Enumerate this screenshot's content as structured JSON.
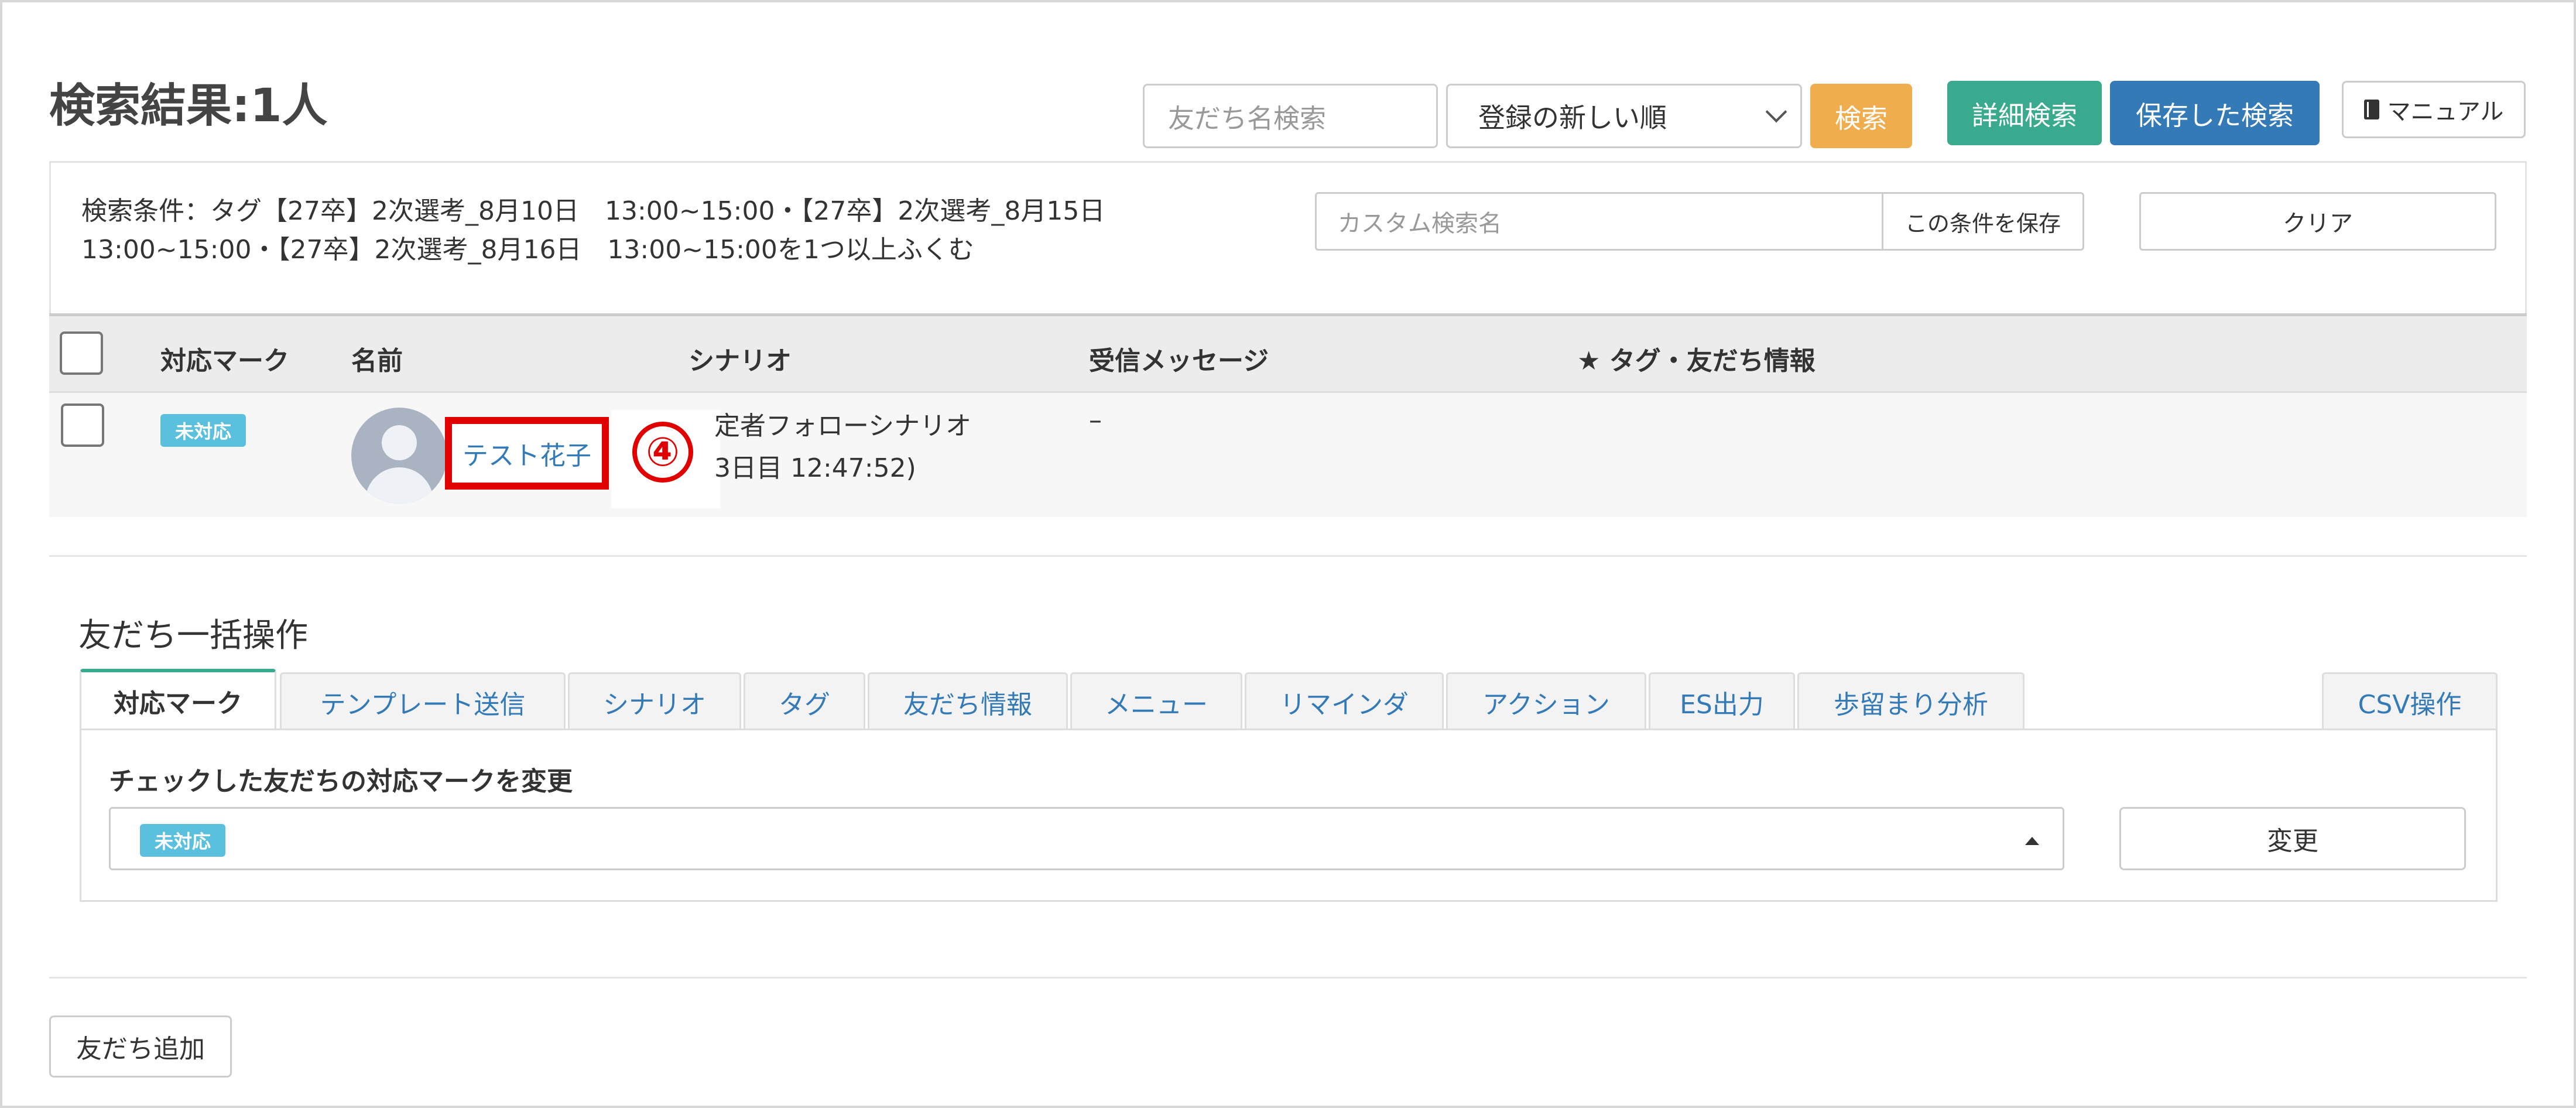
{
  "page": {
    "title": "検索結果:1人"
  },
  "header": {
    "name_search_placeholder": "友だち名検索",
    "sort_selected": "登録の新しい順",
    "search_label": "検索",
    "detail_search_label": "詳細検索",
    "saved_search_label": "保存した検索",
    "manual_label": "マニュアル"
  },
  "conditions": {
    "line1": "検索条件：タグ【27卒】2次選考_8月10日　13:00~15:00・【27卒】2次選考_8月15日",
    "line2": "13:00~15:00・【27卒】2次選考_8月16日　13:00~15:00を1つ以上ふくむ",
    "custom_name_placeholder": "カスタム検索名",
    "save_condition_label": "この条件を保存",
    "clear_label": "クリア"
  },
  "table": {
    "headers": {
      "mark": "対応マーク",
      "name": "名前",
      "scenario": "シナリオ",
      "message": "受信メッセージ",
      "tags": "★ タグ・友だち情報"
    },
    "rows": [
      {
        "mark": "未対応",
        "name": "テスト花子",
        "scenario_line1": "定者フォローシナリオ",
        "scenario_line2": "3日目 12:47:52)",
        "message": "–"
      }
    ]
  },
  "annotation": {
    "marker": "④",
    "color": "#e10000"
  },
  "bulk": {
    "title": "友だち一括操作",
    "tabs": [
      "対応マーク",
      "テンプレート送信",
      "シナリオ",
      "タグ",
      "友だち情報",
      "メニュー",
      "リマインダ",
      "アクション",
      "ES出力",
      "歩留まり分析",
      "CSV操作"
    ],
    "active_tab": "対応マーク",
    "panel_label": "チェックした友だちの対応マークを変更",
    "selected_mark": "未対応",
    "change_label": "変更"
  },
  "footer": {
    "add_friend_label": "友だち追加"
  },
  "colors": {
    "accent_orange": "#f0ad4e",
    "accent_green": "#3aaa8e",
    "accent_blue": "#337ab7",
    "badge": "#5bc0de"
  }
}
